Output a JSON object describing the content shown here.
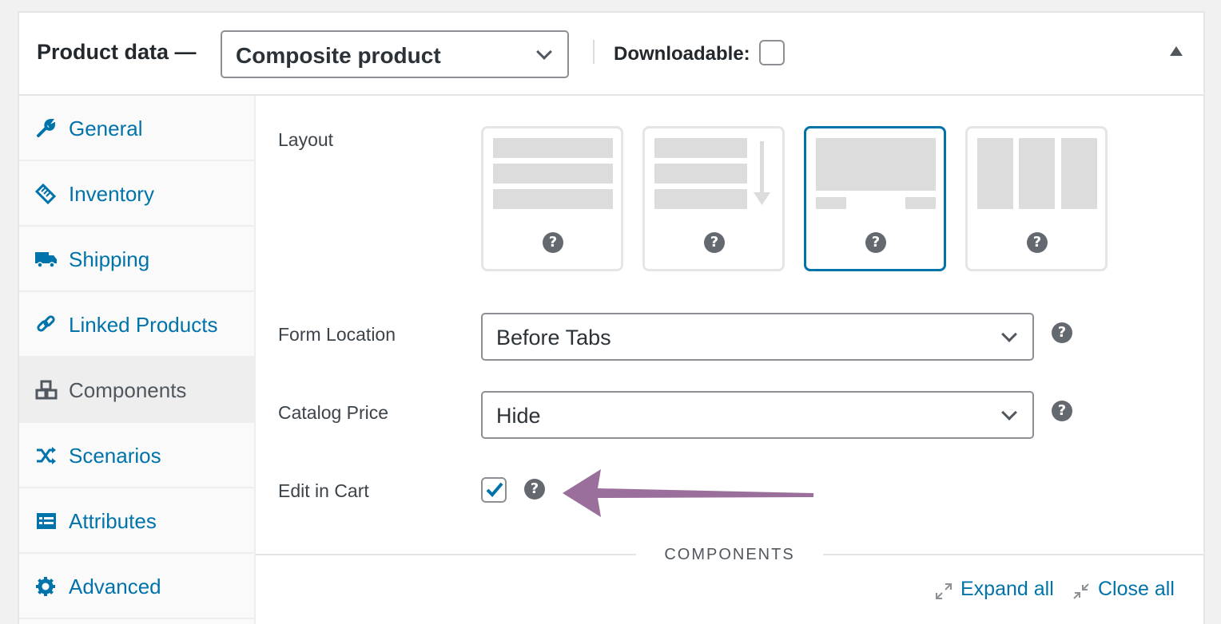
{
  "header": {
    "title": "Product data —",
    "product_type": "Composite product",
    "downloadable_label": "Downloadable:"
  },
  "sidebar": {
    "items": [
      {
        "label": "General",
        "icon": "wrench-icon"
      },
      {
        "label": "Inventory",
        "icon": "tag-icon"
      },
      {
        "label": "Shipping",
        "icon": "truck-icon"
      },
      {
        "label": "Linked Products",
        "icon": "link-icon"
      },
      {
        "label": "Components",
        "icon": "cubes-icon",
        "active": true
      },
      {
        "label": "Scenarios",
        "icon": "shuffle-icon"
      },
      {
        "label": "Attributes",
        "icon": "list-icon"
      },
      {
        "label": "Advanced",
        "icon": "gear-icon"
      }
    ]
  },
  "main": {
    "layout_label": "Layout",
    "layout_options": [
      "stacked",
      "progressive",
      "stepped",
      "componentized"
    ],
    "layout_selected": "stepped",
    "form_location": {
      "label": "Form Location",
      "value": "Before Tabs"
    },
    "catalog_price": {
      "label": "Catalog Price",
      "value": "Hide"
    },
    "edit_in_cart": {
      "label": "Edit in Cart",
      "checked": true
    },
    "help_glyph": "?",
    "components_section_title": "COMPONENTS",
    "expand_all": "Expand all",
    "close_all": "Close all"
  },
  "colors": {
    "link": "#0073aa",
    "selected_border": "#0073aa",
    "arrow": "#9b6f9b"
  }
}
